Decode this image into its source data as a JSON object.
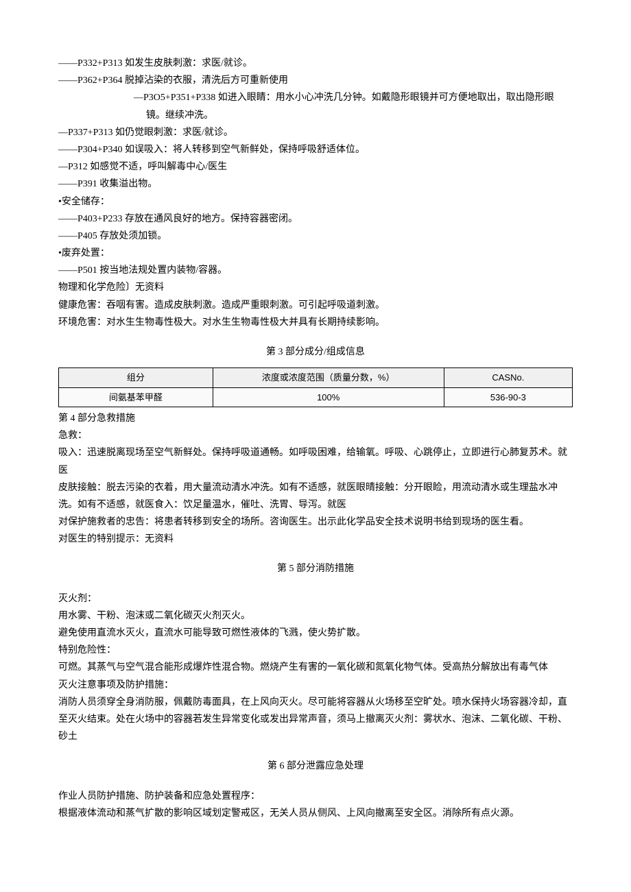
{
  "p_items": [
    "——P332+P313 如发生皮肤刺激：求医/就诊。",
    "——P362+P364 脱掉沾染的衣服，清洗后方可重新使用",
    "—P3O5+P351+P338 如进入眼睛：用水小心冲洗几分钟。如戴隐形眼镜并可方便地取出，取出隐形眼镜。继续冲洗。",
    "—P337+P313 如仍觉眼刺激：求医/就诊。",
    "——P304+P340 如误吸入：将人转移到空气新鲜处，保持呼吸舒适体位。",
    "—P312 如感觉不适，呼叫解毒中心/医生",
    "——P391 收集溢出物。"
  ],
  "storage_title": "•安全储存：",
  "storage_items": [
    "——P403+P233 存放在通风良好的地方。保持容器密闭。",
    "——P405 存放处须加锁。"
  ],
  "disposal_title": "•废弃处置：",
  "disposal_items": [
    "——P501 按当地法规处置内装物/容器。"
  ],
  "phys_chem": "物理和化学危险〕无资料",
  "health": "健康危害：吞咽有害。造成皮肤刺激。造成严重眼刺激。可引起呼吸道刺激。",
  "env": "环境危害：对水生生物毒性极大。对水生生物毒性极大并具有长期持续影响。",
  "section3_title": "第 3 部分成分/组成信息",
  "table": {
    "headers": [
      "组分",
      "浓度或浓度范围（质量分数，%）",
      "CASNo."
    ],
    "row": [
      "间氨基苯甲醛",
      "100%",
      "536-90-3"
    ]
  },
  "section4_title": "第 4 部分急救措施",
  "s4_lines": [
    "急救：",
    "吸入：迅速脱离现场至空气新鲜处。保持呼吸道通畅。如呼吸困难，给输氧。呼吸、心跳停止，立即进行心肺复苏术。就医",
    "皮肤接触：脱去污染的衣着，用大量流动清水冲洗。如有不适感，就医眼晴接触：分开眼睑，用流动清水或生理盐水冲洗。如有不适感，就医食入：饮足量温水，催吐、洗胃、导泻。就医",
    "对保护施救者的忠告：将患者转移到安全的场所。咨询医生。出示此化学品安全技术说明书给到现场的医生看。",
    "对医生的特别提示：无资料"
  ],
  "section5_title": "第 5 部分消防措施",
  "s5_lines": [
    "灭火剂：",
    "用水雾、干粉、泡沫或二氧化碳灭火剂灭火。",
    "避免使用直流水灭火，直流水可能导致可燃性液体的飞溅，使火势扩散。",
    "特别危险性：",
    "可燃。其蒸气与空气混合能形成爆炸性混合物。燃烧产生有害的一氧化碳和氮氧化物气体。受高热分解放出有毒气体",
    "灭火注意事项及防护措施：",
    "消防人员须穿全身消防服，佩戴防毒面具，在上风向灭火。尽可能将容器从火场移至空旷处。喷水保持火场容器冷却，直至灭火结束。处在火场中的容器若发生异常变化或发出异常声音，须马上撤离灭火剂：雾状水、泡沫、二氧化碳、干粉、砂土"
  ],
  "section6_title": "第 6 部分泄露应急处理",
  "s6_lines": [
    "作业人员防护措施、防护装备和应急处置程序：",
    "根据液体流动和蒸气扩散的影响区域划定警戒区，无关人员从侧风、上风向撤离至安全区。消除所有点火源。"
  ]
}
